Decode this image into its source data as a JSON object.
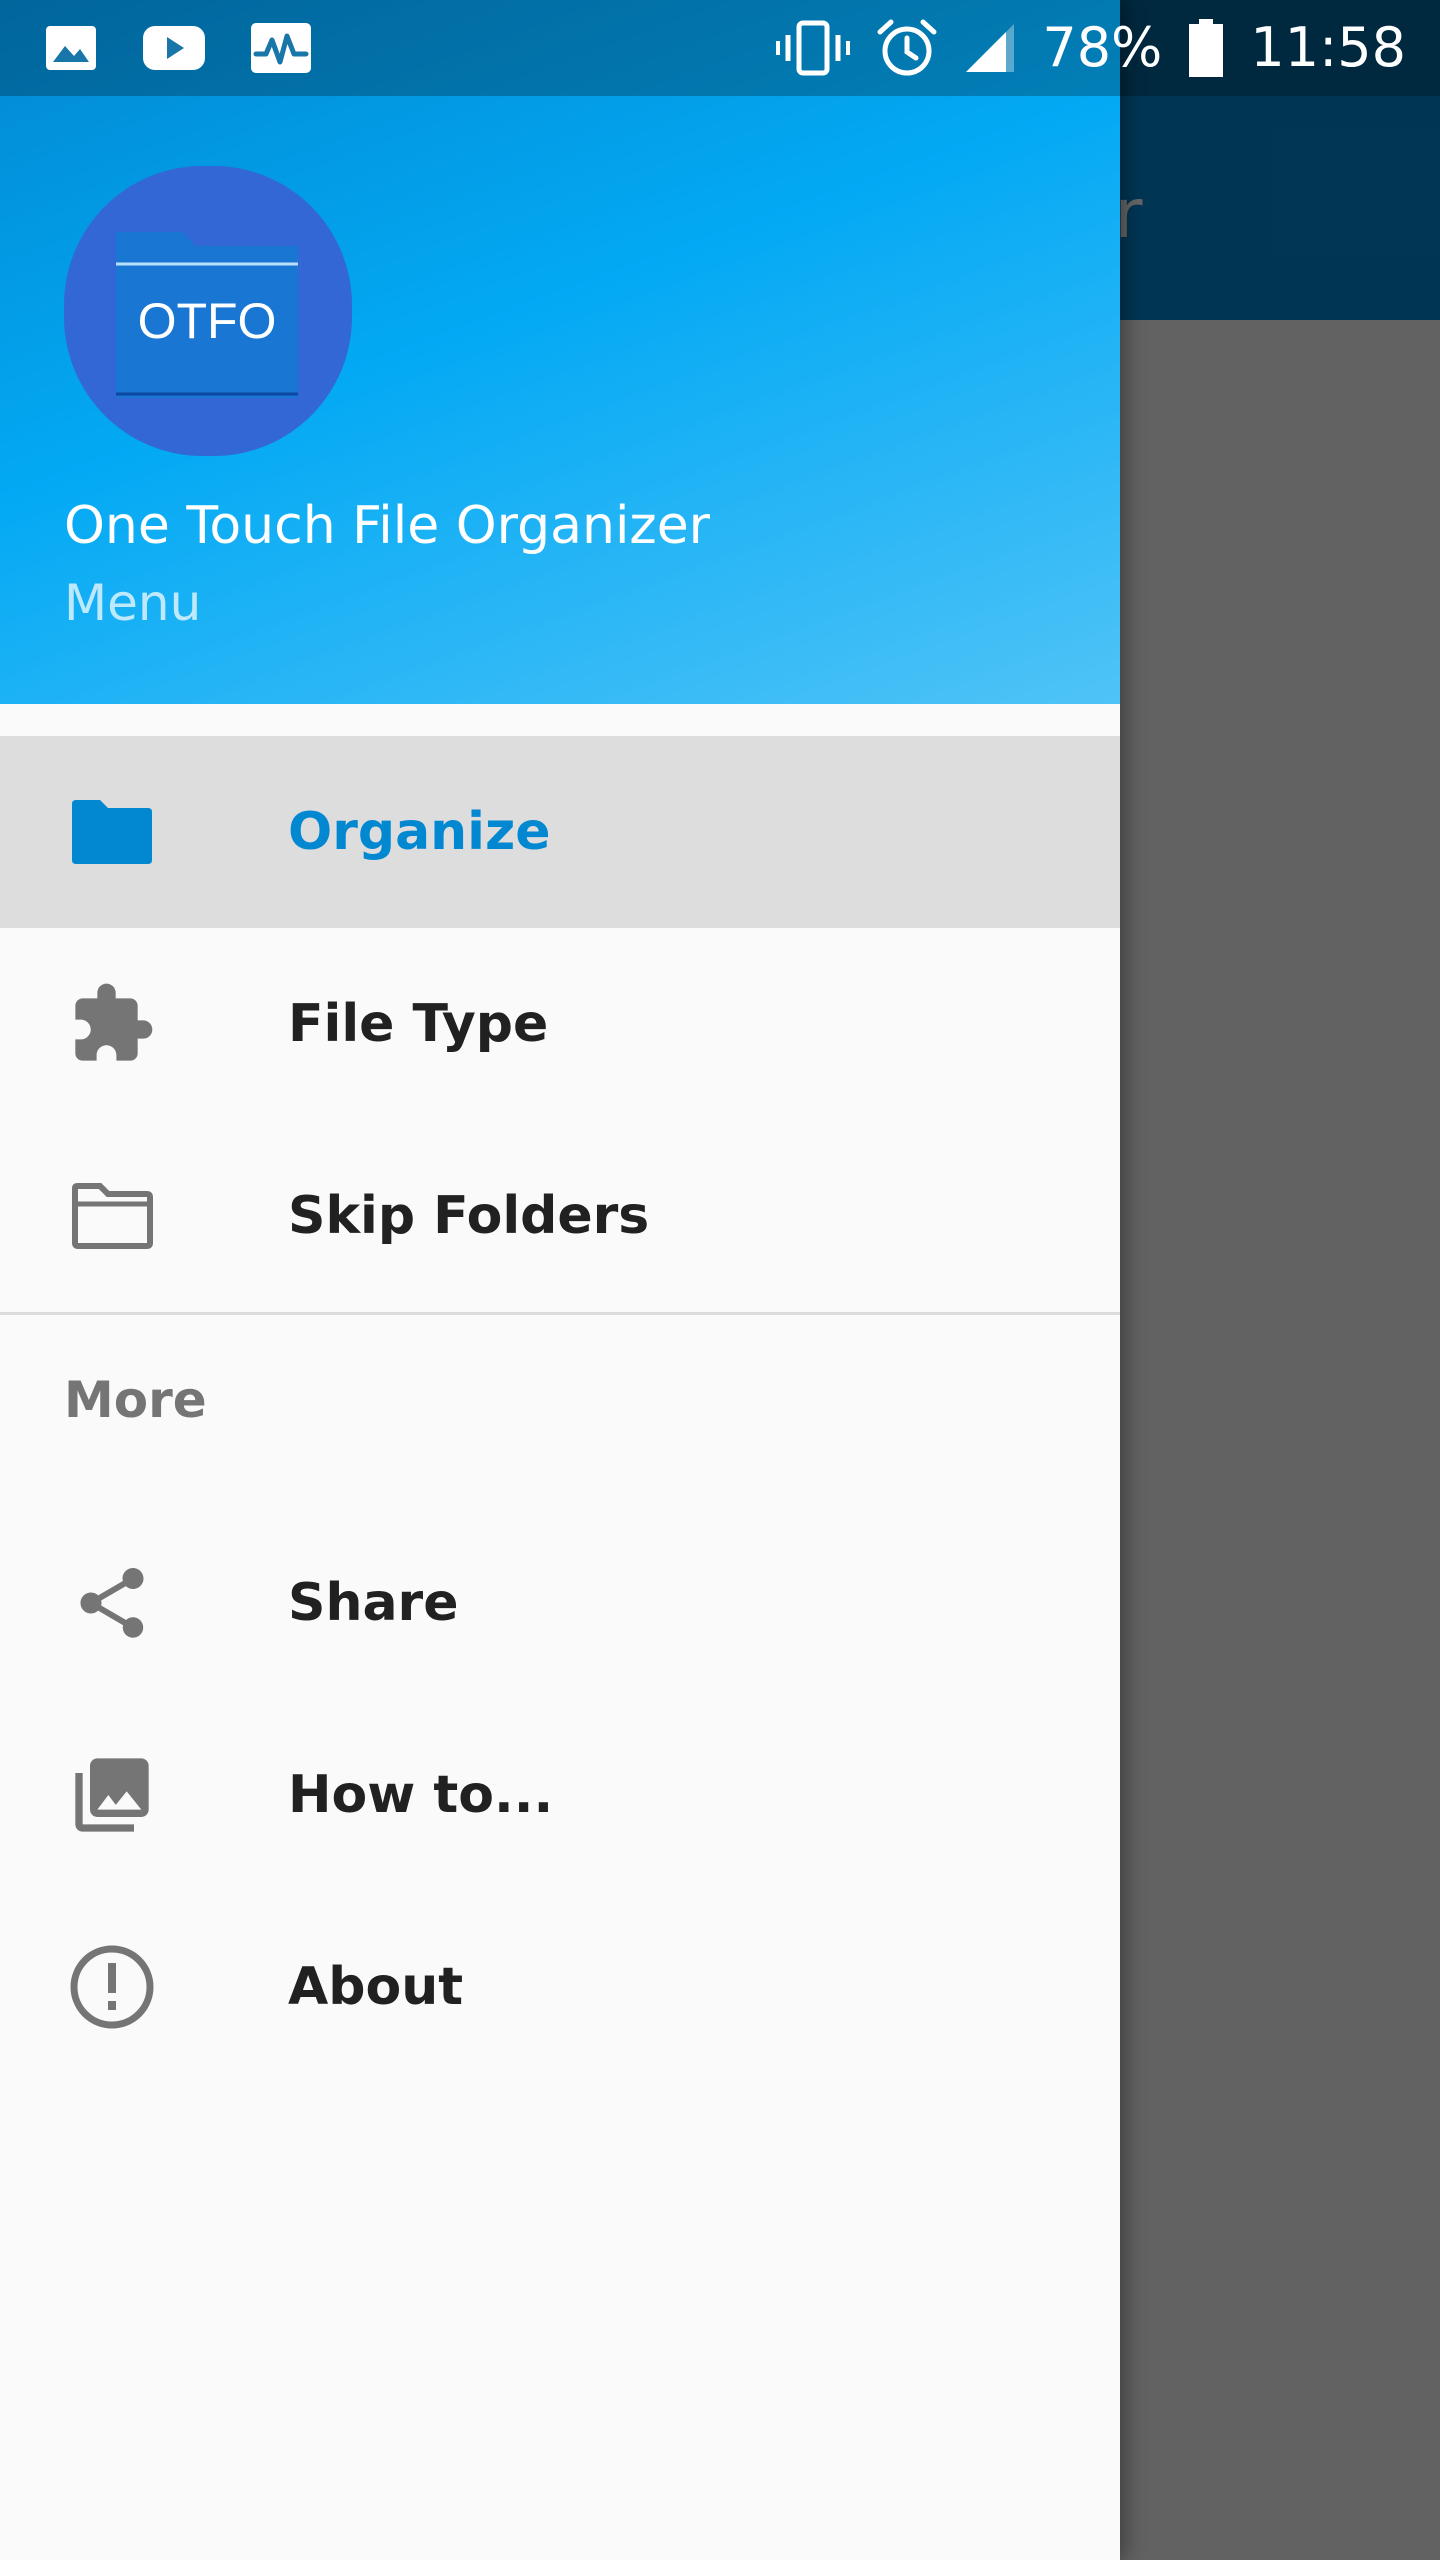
{
  "status_bar": {
    "battery": "78%",
    "time": "11:58",
    "left_icons": [
      "gallery-icon",
      "youtube-icon",
      "activity-icon"
    ],
    "right_icons": [
      "vibrate-icon",
      "alarm-icon",
      "signal-icon",
      "battery-icon"
    ]
  },
  "background_app": {
    "title_fragment": "er"
  },
  "drawer": {
    "header": {
      "logo_text": "OTFO",
      "title": "One Touch File Organizer",
      "subtitle": "Menu"
    },
    "items": [
      {
        "label": "Organize",
        "icon": "folder-icon",
        "active": true
      },
      {
        "label": "File Type",
        "icon": "puzzle-icon",
        "active": false
      },
      {
        "label": "Skip Folders",
        "icon": "folder-outline-icon",
        "active": false
      }
    ],
    "section": {
      "title": "More",
      "items": [
        {
          "label": "Share",
          "icon": "share-icon"
        },
        {
          "label": "How to...",
          "icon": "photo-library-icon"
        },
        {
          "label": "About",
          "icon": "info-icon"
        }
      ]
    }
  },
  "colors": {
    "accent": "#0288d1",
    "header_gradient_start": "#0288d1",
    "header_gradient_end": "#4fc3f7",
    "logo_bg": "#3367d6",
    "icon_grey": "#757575",
    "scrim": "#666666"
  }
}
